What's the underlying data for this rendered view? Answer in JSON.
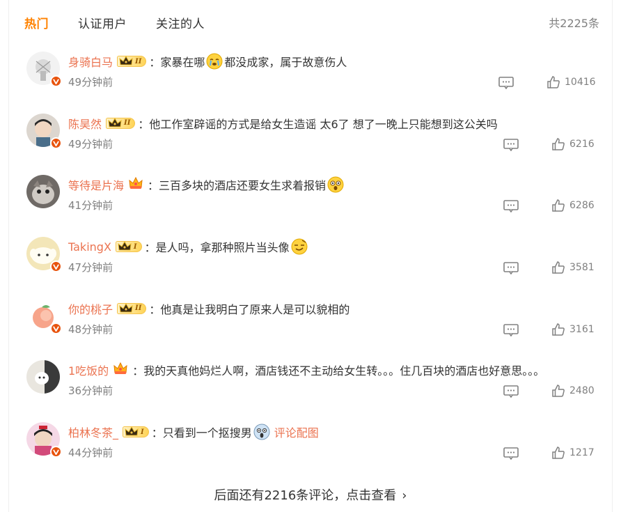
{
  "tabs": [
    {
      "label": "热门",
      "active": true
    },
    {
      "label": "认证用户",
      "active": false
    },
    {
      "label": "关注的人",
      "active": false
    }
  ],
  "total": "共2225条",
  "colors": {
    "accent": "#ff8200",
    "username": "#eb7350",
    "meta": "#808080"
  },
  "comments": [
    {
      "user": "身骑白马",
      "badge": "crown-II",
      "text_a": "：家暴在哪",
      "emoji": "crying-emoji",
      "text_b": "都没成家，属于故意伤人",
      "link": "",
      "time": "49分钟前",
      "likes": "10416",
      "verified": true
    },
    {
      "user": "陈昊然",
      "badge": "crown-II",
      "text_a": "：他工作室辟谣的方式是给女生造谣 太6了 想了一晚上只能想到这公关吗",
      "emoji": "",
      "text_b": "",
      "link": "",
      "time": "49分钟前",
      "likes": "6216",
      "verified": true
    },
    {
      "user": "等待是片海",
      "badge": "small-crown",
      "text_a": "：三百多块的酒店还要女生求着报销",
      "emoji": "shocked-emoji",
      "text_b": "",
      "link": "",
      "time": "41分钟前",
      "likes": "6286",
      "verified": false
    },
    {
      "user": "TakingX",
      "badge": "crown-I",
      "text_a": "：是人吗，拿那种照片当头像",
      "emoji": "smirk-emoji",
      "text_b": "",
      "link": "",
      "time": "47分钟前",
      "likes": "3581",
      "verified": true
    },
    {
      "user": "你的桃子",
      "badge": "crown-II",
      "text_a": "：他真是让我明白了原来人是可以貌相的",
      "emoji": "",
      "text_b": "",
      "link": "",
      "time": "48分钟前",
      "likes": "3161",
      "verified": true
    },
    {
      "user": "1吃饭的",
      "badge": "small-crown",
      "text_a": "：我的天真他妈烂人啊，酒店钱还不主动给女生转。。。住几百块的酒店也好意思。。。",
      "emoji": "",
      "text_b": "",
      "link": "",
      "time": "36分钟前",
      "likes": "2480",
      "verified": false
    },
    {
      "user": "柏林冬茶_",
      "badge": "crown-I",
      "text_a": "：只看到一个抠搜男",
      "emoji": "scream-emoji",
      "text_b": "",
      "link": "评论配图",
      "time": "44分钟前",
      "likes": "1217",
      "verified": true
    }
  ],
  "more": "后面还有2216条评论，点击查看"
}
